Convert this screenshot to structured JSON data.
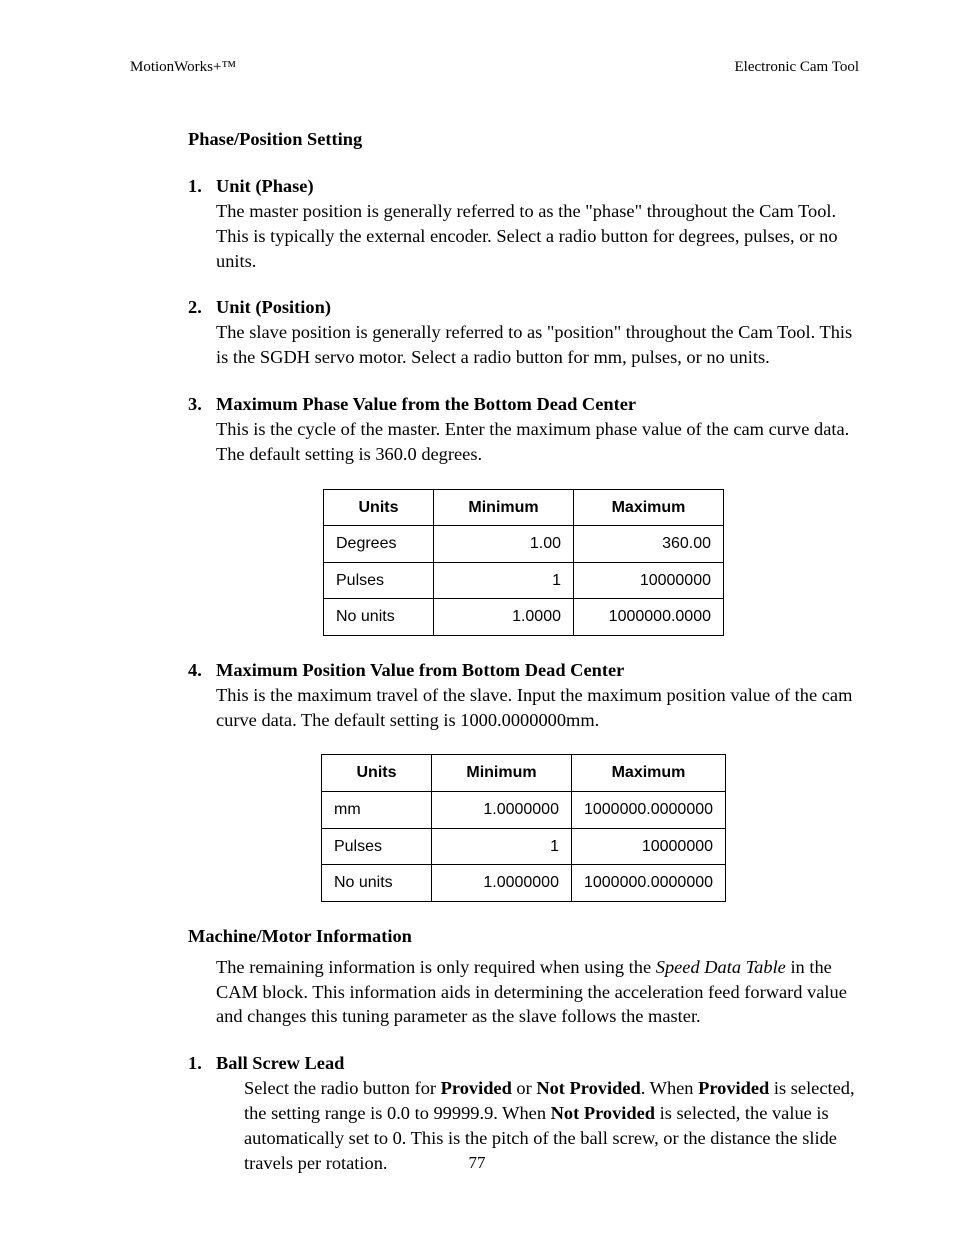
{
  "header": {
    "left": "MotionWorks+™",
    "right": "Electronic Cam Tool"
  },
  "section1": {
    "title": "Phase/Position Setting",
    "items": [
      {
        "num": "1.",
        "title": "Unit (Phase)",
        "text": "The master position is generally referred to as the \"phase\" throughout the Cam Tool. This is typically the external encoder.  Select a radio button for degrees, pulses, or no units."
      },
      {
        "num": "2.",
        "title": "Unit (Position)",
        "text": "The slave position is generally referred to as \"position\" throughout the Cam Tool. This is the SGDH servo motor.  Select a radio button for mm, pulses, or no units."
      },
      {
        "num": "3.",
        "title": "Maximum Phase Value from the Bottom Dead Center",
        "text": "This is the cycle of the master.  Enter the maximum phase value of the cam curve data.  The default setting is  360.0 degrees."
      },
      {
        "num": "4.",
        "title": "Maximum Position Value from Bottom Dead Center",
        "text": "This is the maximum travel of the slave.  Input the maximum position value of the cam curve data. The default setting is 1000.0000000mm."
      }
    ]
  },
  "table1": {
    "headers": [
      "Units",
      "Minimum",
      "Maximum"
    ],
    "rows": [
      [
        "Degrees",
        "1.00",
        "360.00"
      ],
      [
        "Pulses",
        "1",
        "10000000"
      ],
      [
        "No units",
        "1.0000",
        "1000000.0000"
      ]
    ]
  },
  "table2": {
    "headers": [
      "Units",
      "Minimum",
      "Maximum"
    ],
    "rows": [
      [
        "mm",
        "1.0000000",
        "1000000.0000000"
      ],
      [
        "Pulses",
        "1",
        "10000000"
      ],
      [
        "No units",
        "1.0000000",
        "1000000.0000000"
      ]
    ]
  },
  "section2": {
    "title": "Machine/Motor Information",
    "intro_pre": "The remaining information is only required when using the ",
    "intro_italic": "Speed Data Table",
    "intro_post": " in the CAM block.  This information aids in determining the acceleration feed forward value and changes this tuning parameter as the slave follows the master.",
    "item": {
      "num": "1.",
      "title": "Ball Screw Lead",
      "t1": "Select the radio button for ",
      "b1": "Provided",
      "t2": " or ",
      "b2": "Not Provided",
      "t3": ".  When ",
      "b3": "Provided",
      "t4": " is selected, the setting range is 0.0 to 99999.9.  When ",
      "b4": "Not Provided",
      "t5": " is selected, the value is automatically set to 0. This is the pitch of the ball screw, or the distance the slide travels per rotation."
    }
  },
  "footer": {
    "page": "77"
  }
}
